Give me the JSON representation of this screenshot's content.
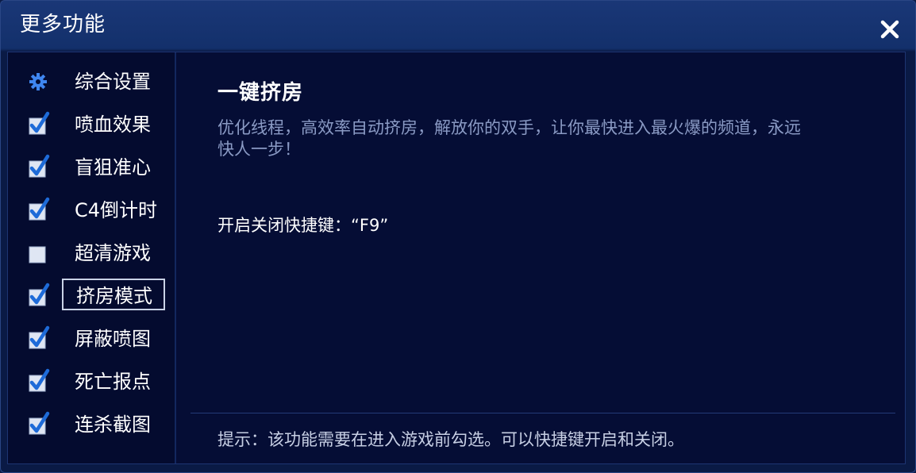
{
  "window": {
    "title": "更多功能"
  },
  "sidebar": {
    "items": [
      {
        "label": "综合设置",
        "icon": "gear-icon",
        "state": "settings"
      },
      {
        "label": "喷血效果",
        "icon": "checkbox",
        "state": "checked"
      },
      {
        "label": "盲狙准心",
        "icon": "checkbox",
        "state": "checked"
      },
      {
        "label": "C4倒计时",
        "icon": "checkbox",
        "state": "checked"
      },
      {
        "label": "超清游戏",
        "icon": "checkbox",
        "state": "unchecked"
      },
      {
        "label": "挤房模式",
        "icon": "checkbox",
        "state": "checked",
        "selected": true
      },
      {
        "label": "屏蔽喷图",
        "icon": "checkbox",
        "state": "checked"
      },
      {
        "label": "死亡报点",
        "icon": "checkbox",
        "state": "checked"
      },
      {
        "label": "连杀截图",
        "icon": "checkbox",
        "state": "checked"
      }
    ]
  },
  "content": {
    "feature_title": "一键挤房",
    "description": "优化线程，高效率自动挤房，解放你的双手，让你最快进入最火爆的频道，永远快人一步！",
    "hotkey": "开启关闭快捷键：“F9”",
    "tip": "提示：该功能需要在进入游戏前勾选。可以快捷键开启和关闭。"
  },
  "colors": {
    "accent_blue": "#3f86f0",
    "check_mark": "#1e6bd8",
    "checkbox_bg": "#dfe6f3",
    "panel_bg": "#050d35",
    "title_bar": "#13306b"
  }
}
